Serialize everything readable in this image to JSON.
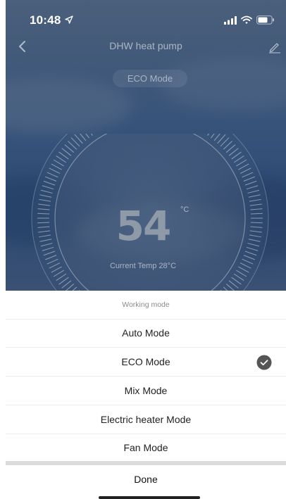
{
  "status_bar": {
    "time": "10:48",
    "location_icon": "location-arrow-icon",
    "signal_icon": "cellular-signal-icon",
    "wifi_icon": "wifi-icon",
    "battery_icon": "battery-icon"
  },
  "header": {
    "back_icon": "chevron-left-icon",
    "title": "DHW heat pump",
    "edit_icon": "pencil-icon"
  },
  "mode_badge": "ECO Mode",
  "thermostat": {
    "temperature": "54",
    "unit": "°C",
    "current_temp_label": "Current Temp 28°C"
  },
  "sheet": {
    "title": "Working mode",
    "options": [
      "Auto Mode",
      "ECO Mode",
      "Mix Mode",
      "Electric heater Mode",
      "Fan Mode"
    ],
    "selected_option": "ECO Mode",
    "check_icon": "checkmark-circle-icon",
    "done_label": "Done"
  },
  "colors": {
    "sky_top": "#4a5f7b",
    "sky_mid": "#345179",
    "sheet_bg": "#ffffff",
    "divider": "#dcdcdc",
    "check_bg": "#555555"
  }
}
